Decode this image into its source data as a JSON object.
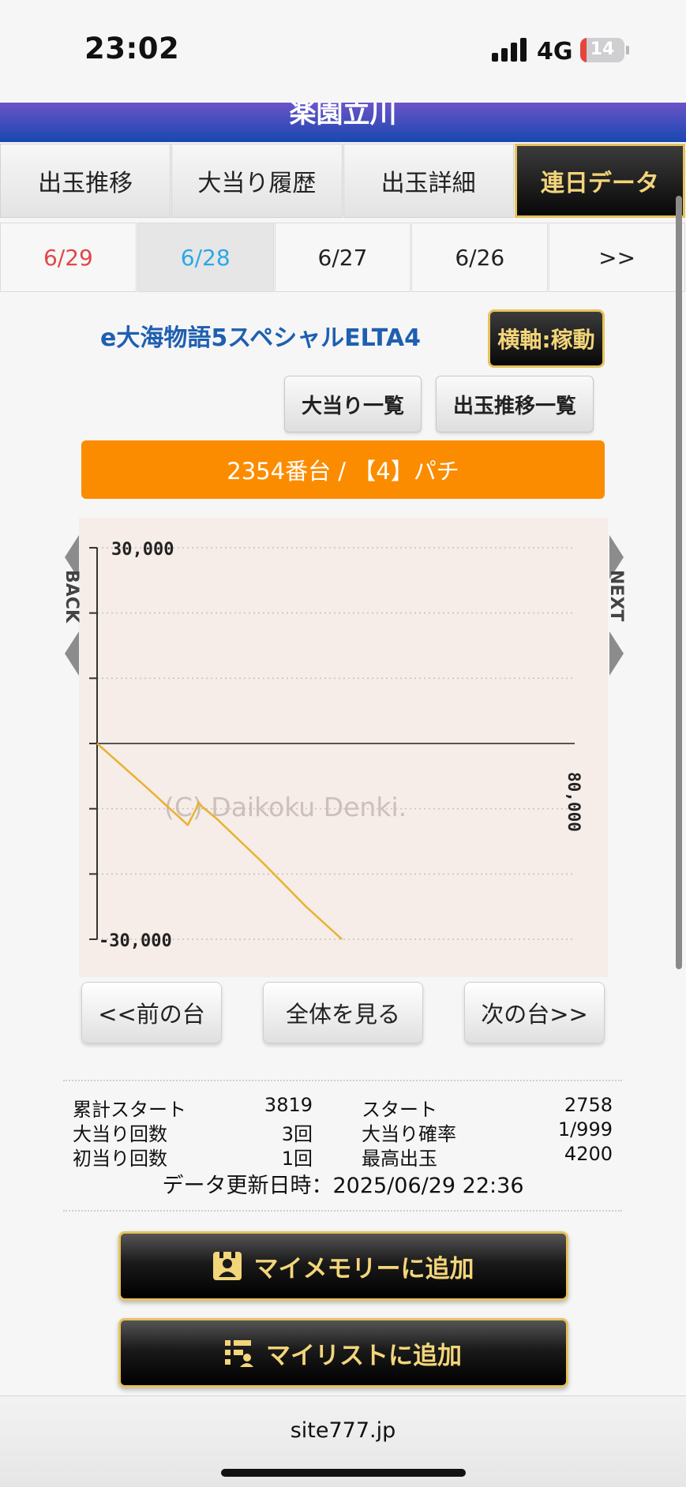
{
  "status_bar": {
    "time": "23:02",
    "network": "4G",
    "battery": "14",
    "battery_level": 14
  },
  "header": {
    "site_title": "楽園立川"
  },
  "tabs": [
    {
      "label": "出玉推移",
      "active": false
    },
    {
      "label": "大当り履歴",
      "active": false
    },
    {
      "label": "出玉詳細",
      "active": false
    },
    {
      "label": "連日データ",
      "active": true
    }
  ],
  "dates": [
    {
      "label": "6/29",
      "style": "red"
    },
    {
      "label": "6/28",
      "style": "sel"
    },
    {
      "label": "6/27",
      "style": ""
    },
    {
      "label": "6/26",
      "style": ""
    },
    {
      "label": ">>",
      "style": ""
    }
  ],
  "machine": {
    "name": "e大海物語5スペシャルELTA4",
    "axis_button": "横軸:稼動",
    "jackpot_list_button": "大当り一覧",
    "payout_list_button": "出玉推移一覧",
    "unit_label": "2354番台 / 【4】パチ"
  },
  "chart_data": {
    "type": "line",
    "y_tick_labels": {
      "top": "30,000",
      "bottom": "-30,000"
    },
    "x_end_label": "80,000",
    "ylim": [
      -30000,
      30000
    ],
    "xlim": [
      0,
      80000
    ],
    "grid": true,
    "watermark": "(C) Daikoku Denki.",
    "back_label": "BACK",
    "next_label": "NEXT",
    "series": [
      {
        "color": "#e8b230",
        "points": [
          [
            0,
            0
          ],
          [
            8000,
            -6500
          ],
          [
            14000,
            -11500
          ],
          [
            15200,
            -12500
          ],
          [
            16600,
            -10000
          ],
          [
            17000,
            -9000
          ],
          [
            17500,
            -9600
          ],
          [
            20000,
            -11500
          ],
          [
            28000,
            -18500
          ],
          [
            35000,
            -25000
          ],
          [
            41000,
            -30000
          ]
        ]
      }
    ]
  },
  "nav": {
    "prev": "<<前の台",
    "all": "全体を見る",
    "next": "次の台>>"
  },
  "stats": {
    "left": [
      {
        "label": "累計スタート",
        "value": "3819"
      },
      {
        "label": "大当り回数",
        "value": "3回"
      },
      {
        "label": "初当り回数",
        "value": "1回"
      }
    ],
    "right": [
      {
        "label": "スタート",
        "value": "2758"
      },
      {
        "label": "大当り確率",
        "value": "1/999"
      },
      {
        "label": "最高出玉",
        "value": "4200"
      }
    ],
    "updated": "データ更新日時：2025/06/29 22:36"
  },
  "actions": {
    "my_memory": "マイメモリーに追加",
    "my_list": "マイリストに追加"
  },
  "browser": {
    "url": "site777.jp"
  }
}
